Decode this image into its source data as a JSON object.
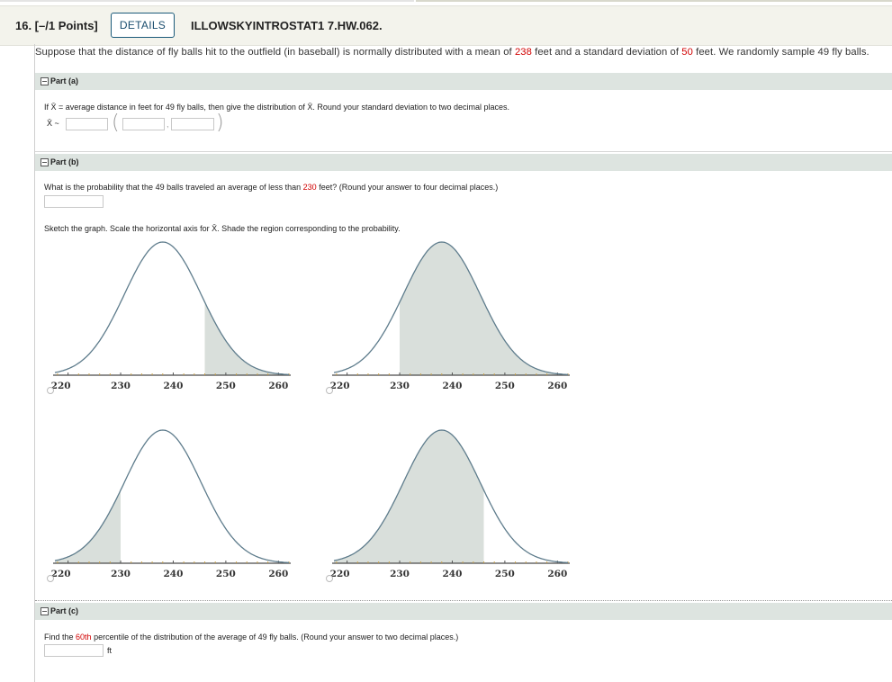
{
  "header": {
    "question_number": "16.  [–/1 Points]",
    "details_label": "DETAILS",
    "question_code": "ILLOWSKYINTROSTAT1 7.HW.062."
  },
  "problem": {
    "part1": "Suppose that the distance of fly balls hit to the outfield (in baseball) is normally distributed with a mean of ",
    "mean": "238",
    "part2": " feet and a standard deviation of ",
    "sd": "50",
    "part3": " feet. We randomly sample 49 fly balls."
  },
  "part_a": {
    "label": "Part (a)",
    "prompt": "If X̄ = average distance in feet for 49 fly balls, then give the distribution of X̄. Round your standard deviation to two decimal places.",
    "xbar_symbol": "X̄ ~",
    "comma": ","
  },
  "part_b": {
    "label": "Part (b)",
    "q_part1": "What is the probability that the 49 balls traveled an average of less than ",
    "q_value": "230",
    "q_part2": " feet? (Round your answer to four decimal places.)",
    "sketch_prompt": "Sketch the graph. Scale the horizontal axis for X̄. Shade the region corresponding to the probability.",
    "tick_labels": [
      "220",
      "230",
      "240",
      "250",
      "260"
    ],
    "options": [
      {
        "shade": "right",
        "shade_from": 246
      },
      {
        "shade": "right",
        "shade_from": 230
      },
      {
        "shade": "left",
        "shade_to": 230
      },
      {
        "shade": "left",
        "shade_to": 246
      }
    ]
  },
  "part_c": {
    "label": "Part (c)",
    "q_part1": "Find the ",
    "q_value": "60th",
    "q_part2": " percentile of the distribution of the average of 49 fly balls. (Round your answer to two decimal places.)",
    "unit": "ft"
  },
  "colors": {
    "accent_red": "#d10000",
    "curve": "#5e7c8c",
    "shade": "#d9dfdb",
    "axis_tick": "#c8a14a",
    "part_header_bg": "#dde4e0"
  }
}
